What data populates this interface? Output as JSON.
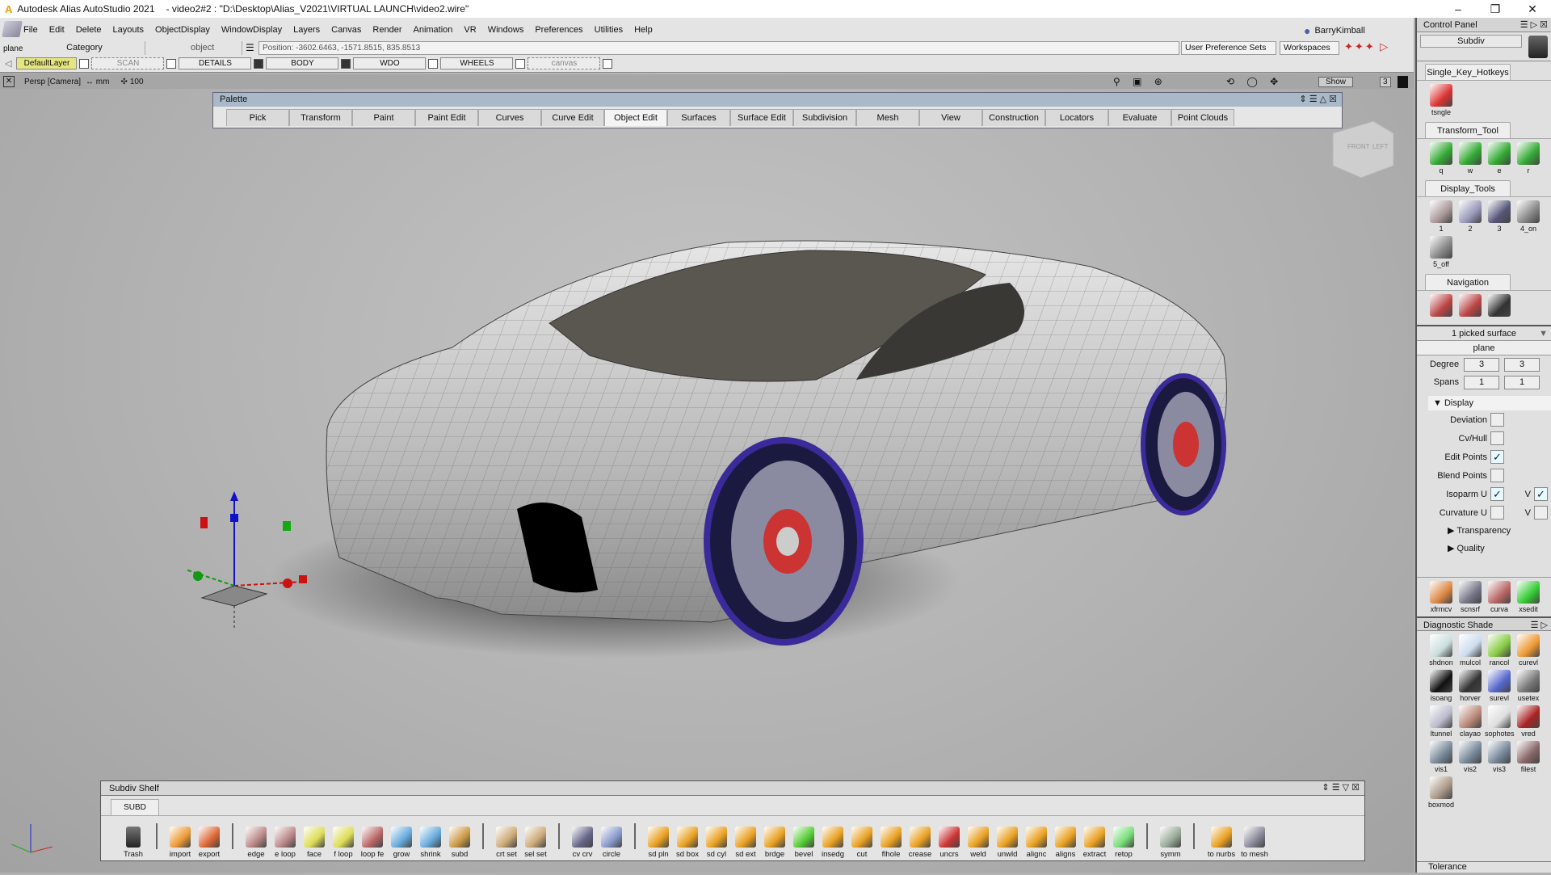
{
  "window": {
    "app": "Autodesk Alias AutoStudio 2021",
    "doc": "- video2#2 : \"D:\\Desktop\\Alias_V2021\\VIRTUAL LAUNCH\\video2.wire\"",
    "minimize": "–",
    "maximize": "❐",
    "close": "✕"
  },
  "menu": [
    "File",
    "Edit",
    "Delete",
    "Layouts",
    "ObjectDisplay",
    "WindowDisplay",
    "Layers",
    "Canvas",
    "Render",
    "Animation",
    "VR",
    "Windows",
    "Preferences",
    "Utilities",
    "Help"
  ],
  "toolbar": {
    "pick_label": "plane",
    "category": "Category",
    "object": "object",
    "position": "Position:  -3602.6463, -1571.8515, 835.8513",
    "user_prefs": "User Preference Sets",
    "workspaces": "Workspaces",
    "user": "BarryKimball"
  },
  "layers": [
    {
      "name": "DefaultLayer",
      "active": true
    },
    {
      "name": "SCAN",
      "dashed": true
    },
    {
      "name": "DETAILS"
    },
    {
      "name": "BODY"
    },
    {
      "name": "WDO"
    },
    {
      "name": "WHEELS"
    },
    {
      "name": "canvas",
      "dashed": true
    }
  ],
  "viewport": {
    "camera": "Persp [Camera]",
    "units": "↔ mm",
    "scale": "100",
    "show": "Show",
    "num": "3",
    "cube_front": "FRONT",
    "cube_left": "LEFT"
  },
  "palette": {
    "title": "Palette",
    "tabs": [
      "Pick",
      "Transform",
      "Paint",
      "Paint Edit",
      "Curves",
      "Curve Edit",
      "Object Edit",
      "Surfaces",
      "Surface Edit",
      "Subdivision",
      "Mesh",
      "View",
      "Construction",
      "Locators",
      "Evaluate",
      "Point Clouds"
    ],
    "active": "Object Edit"
  },
  "control_panel": {
    "title": "Control Panel",
    "mode": "Subdiv",
    "sections": [
      {
        "title": "Single_Key_Hotkeys",
        "items": [
          {
            "label": "tsngle",
            "color": "#d33"
          }
        ]
      },
      {
        "title": "Transform_Tool",
        "items": [
          {
            "label": "q",
            "color": "#3a3"
          },
          {
            "label": "w",
            "color": "#3a3"
          },
          {
            "label": "e",
            "color": "#3a3"
          },
          {
            "label": "r",
            "color": "#3a3"
          }
        ]
      },
      {
        "title": "Display_Tools",
        "items": [
          {
            "label": "1",
            "color": "#a99"
          },
          {
            "label": "2",
            "color": "#99b"
          },
          {
            "label": "3",
            "color": "#557"
          },
          {
            "label": "4_on",
            "color": "#888"
          },
          {
            "label": "5_off",
            "color": "#888"
          }
        ]
      },
      {
        "title": "Navigation",
        "items": [
          {
            "label": "",
            "color": "#b44"
          },
          {
            "label": "",
            "color": "#b44"
          },
          {
            "label": "",
            "color": "#333"
          }
        ]
      }
    ],
    "picked": "1 picked surface",
    "object": "plane",
    "degree_label": "Degree",
    "degree": [
      "3",
      "3"
    ],
    "spans_label": "Spans",
    "spans": [
      "1",
      "1"
    ],
    "display": {
      "title": "Display",
      "rows": [
        {
          "label": "Deviation",
          "checked": false
        },
        {
          "label": "Cv/Hull",
          "checked": false
        },
        {
          "label": "Edit Points",
          "checked": true
        },
        {
          "label": "Blend Points",
          "checked": false
        },
        {
          "label": "Isoparm U",
          "checked": true,
          "v": true
        },
        {
          "label": "Curvature U",
          "checked": false,
          "v": false
        }
      ],
      "v_label": "V",
      "transparency": "Transparency",
      "quality": "Quality"
    },
    "tools2": [
      {
        "label": "xfrmcv",
        "color": "#d84"
      },
      {
        "label": "scnsrf",
        "color": "#778"
      },
      {
        "label": "curva",
        "color": "#b66"
      },
      {
        "label": "xsedit",
        "color": "#3c3"
      }
    ],
    "diag_title": "Diagnostic Shade",
    "diag": [
      {
        "label": "shdnon",
        "color": "#cdd"
      },
      {
        "label": "mulcol",
        "color": "#cde"
      },
      {
        "label": "rancol",
        "color": "#8c4"
      },
      {
        "label": "curevl",
        "color": "#e93"
      },
      {
        "label": "isoang",
        "color": "#111"
      },
      {
        "label": "horver",
        "color": "#333"
      },
      {
        "label": "surevl",
        "color": "#56c"
      },
      {
        "label": "usetex",
        "color": "#777"
      },
      {
        "label": "ltunnel",
        "color": "#bbc"
      },
      {
        "label": "clayao",
        "color": "#b87"
      },
      {
        "label": "sophotes",
        "color": "#ddd"
      },
      {
        "label": "vred",
        "color": "#a22"
      },
      {
        "label": "vis1",
        "color": "#789"
      },
      {
        "label": "vis2",
        "color": "#789"
      },
      {
        "label": "vis3",
        "color": "#789"
      },
      {
        "label": "filest",
        "color": "#866"
      },
      {
        "label": "boxmod",
        "color": "#a98"
      }
    ],
    "tolerance": "Tolerance"
  },
  "shelf": {
    "title": "Subdiv Shelf",
    "tab": "SUBD",
    "trash": "Trash",
    "groups": [
      [
        {
          "label": "import",
          "color": "#e93"
        },
        {
          "label": "export",
          "color": "#d63"
        }
      ],
      [
        {
          "label": "edge",
          "color": "#b88"
        },
        {
          "label": "e loop",
          "color": "#b88"
        },
        {
          "label": "face",
          "color": "#dd5"
        },
        {
          "label": "f loop",
          "color": "#dd5"
        },
        {
          "label": "loop fe",
          "color": "#b66"
        },
        {
          "label": "grow",
          "color": "#6ad"
        },
        {
          "label": "shrink",
          "color": "#6ad"
        },
        {
          "label": "subd",
          "color": "#c94"
        }
      ],
      [
        {
          "label": "crt set",
          "color": "#ca7"
        },
        {
          "label": "sel set",
          "color": "#ca7"
        }
      ],
      [
        {
          "label": "cv crv",
          "color": "#668"
        },
        {
          "label": "circle",
          "color": "#89c"
        }
      ],
      [
        {
          "label": "sd pln",
          "color": "#e9a020"
        },
        {
          "label": "sd box",
          "color": "#e9a020"
        },
        {
          "label": "sd cyl",
          "color": "#e9a020"
        },
        {
          "label": "sd ext",
          "color": "#e9a020"
        },
        {
          "label": "brdge",
          "color": "#e9a020"
        },
        {
          "label": "bevel",
          "color": "#5c3"
        },
        {
          "label": "insedg",
          "color": "#e9a020"
        },
        {
          "label": "cut",
          "color": "#e9a020"
        },
        {
          "label": "flhole",
          "color": "#e9a020"
        },
        {
          "label": "crease",
          "color": "#e9a020"
        },
        {
          "label": "uncrs",
          "color": "#c33"
        },
        {
          "label": "weld",
          "color": "#e9a020"
        },
        {
          "label": "unwld",
          "color": "#e9a020"
        },
        {
          "label": "alignc",
          "color": "#e9a020"
        },
        {
          "label": "aligns",
          "color": "#e9a020"
        },
        {
          "label": "extract",
          "color": "#e9a020"
        },
        {
          "label": "retop",
          "color": "#7d7"
        }
      ],
      [
        {
          "label": "symm",
          "color": "#9a9"
        }
      ],
      [
        {
          "label": "to nurbs",
          "color": "#e9a020"
        },
        {
          "label": "to mesh",
          "color": "#889"
        }
      ]
    ]
  }
}
